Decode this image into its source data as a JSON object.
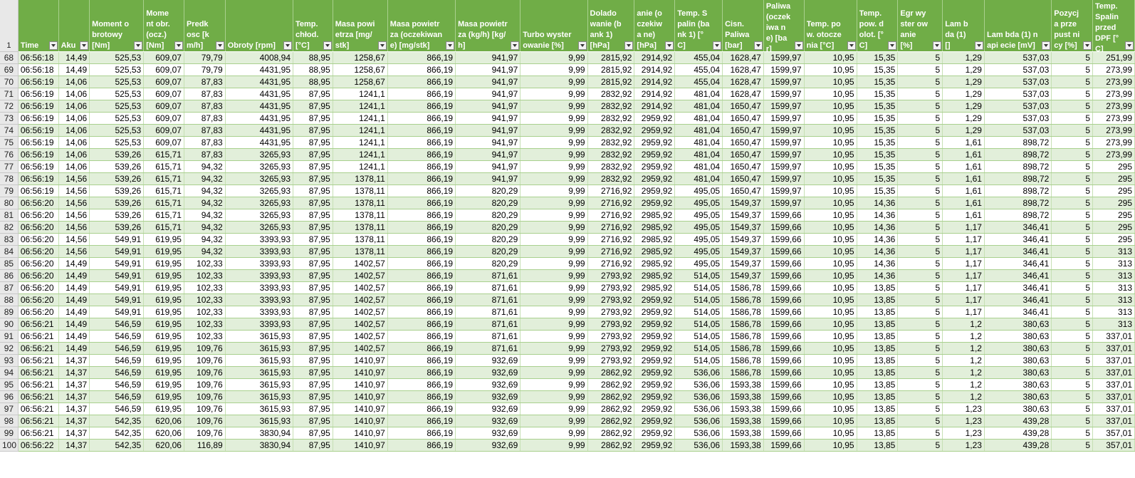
{
  "header_row_number": "1",
  "columns": [
    {
      "label": "Time",
      "width": 56
    },
    {
      "label": "Aku",
      "width": 43
    },
    {
      "label": "Moment obrotowy [Nm]",
      "width": 75
    },
    {
      "label": "Moment obr. (ocz.) [Nm]",
      "width": 56
    },
    {
      "label": "Predkosc [km/h]",
      "width": 57
    },
    {
      "label": "Obroty [rpm]",
      "width": 94
    },
    {
      "label": "Temp. chłod. [°C]",
      "width": 55
    },
    {
      "label": "Masa powietrza [mg/stk]",
      "width": 76
    },
    {
      "label": "Masa powietrza (oczekiwane) [mg/stk]",
      "width": 94
    },
    {
      "label": "Masa powietrza (kg/h) [kg/h]",
      "width": 90
    },
    {
      "label": "Turbo wyster owanie [%]",
      "width": 93
    },
    {
      "label": "Dolado wanie (bank 1) [hPa]",
      "width": 65
    },
    {
      "label": "anie (oczekiwa ne) [hPa]",
      "width": 56
    },
    {
      "label": "Temp. Spalin (bank 1) [°C]",
      "width": 66
    },
    {
      "label": "Cisn. Paliwa [bar]",
      "width": 57
    },
    {
      "label": "Paliwa (oczekiwa ne) [bar]",
      "width": 56
    },
    {
      "label": "Temp. pow. otoczenia [°C]",
      "width": 73
    },
    {
      "label": "Temp. pow. dolot. [°C]",
      "width": 57
    },
    {
      "label": "Egr wyster owanie [%]",
      "width": 62
    },
    {
      "label": "Lam bda (1) []",
      "width": 58
    },
    {
      "label": "Lam bda (1) napi ecie [mV]",
      "width": 93
    },
    {
      "label": "Pozycja przepust nicy [%]",
      "width": 57
    },
    {
      "label": "Temp. Spalin przed DPF [°C]",
      "width": 58
    }
  ],
  "rows": [
    {
      "n": "68",
      "c": [
        "06:56:18",
        "14,49",
        "525,53",
        "609,07",
        "79,79",
        "4008,94",
        "88,95",
        "1258,67",
        "866,19",
        "941,97",
        "9,99",
        "2815,92",
        "2914,92",
        "455,04",
        "1628,47",
        "1599,97",
        "10,95",
        "15,35",
        "5",
        "1,29",
        "537,03",
        "5",
        "251,99"
      ]
    },
    {
      "n": "69",
      "c": [
        "06:56:18",
        "14,49",
        "525,53",
        "609,07",
        "79,79",
        "4431,95",
        "88,95",
        "1258,67",
        "866,19",
        "941,97",
        "9,99",
        "2815,92",
        "2914,92",
        "455,04",
        "1628,47",
        "1599,97",
        "10,95",
        "15,35",
        "5",
        "1,29",
        "537,03",
        "5",
        "273,99"
      ]
    },
    {
      "n": "70",
      "c": [
        "06:56:19",
        "14,06",
        "525,53",
        "609,07",
        "87,83",
        "4431,95",
        "88,95",
        "1258,67",
        "866,19",
        "941,97",
        "9,99",
        "2815,92",
        "2914,92",
        "455,04",
        "1628,47",
        "1599,97",
        "10,95",
        "15,35",
        "5",
        "1,29",
        "537,03",
        "5",
        "273,99"
      ]
    },
    {
      "n": "71",
      "c": [
        "06:56:19",
        "14,06",
        "525,53",
        "609,07",
        "87,83",
        "4431,95",
        "87,95",
        "1241,1",
        "866,19",
        "941,97",
        "9,99",
        "2832,92",
        "2914,92",
        "481,04",
        "1628,47",
        "1599,97",
        "10,95",
        "15,35",
        "5",
        "1,29",
        "537,03",
        "5",
        "273,99"
      ]
    },
    {
      "n": "72",
      "c": [
        "06:56:19",
        "14,06",
        "525,53",
        "609,07",
        "87,83",
        "4431,95",
        "87,95",
        "1241,1",
        "866,19",
        "941,97",
        "9,99",
        "2832,92",
        "2914,92",
        "481,04",
        "1650,47",
        "1599,97",
        "10,95",
        "15,35",
        "5",
        "1,29",
        "537,03",
        "5",
        "273,99"
      ]
    },
    {
      "n": "73",
      "c": [
        "06:56:19",
        "14,06",
        "525,53",
        "609,07",
        "87,83",
        "4431,95",
        "87,95",
        "1241,1",
        "866,19",
        "941,97",
        "9,99",
        "2832,92",
        "2959,92",
        "481,04",
        "1650,47",
        "1599,97",
        "10,95",
        "15,35",
        "5",
        "1,29",
        "537,03",
        "5",
        "273,99"
      ]
    },
    {
      "n": "74",
      "c": [
        "06:56:19",
        "14,06",
        "525,53",
        "609,07",
        "87,83",
        "4431,95",
        "87,95",
        "1241,1",
        "866,19",
        "941,97",
        "9,99",
        "2832,92",
        "2959,92",
        "481,04",
        "1650,47",
        "1599,97",
        "10,95",
        "15,35",
        "5",
        "1,29",
        "537,03",
        "5",
        "273,99"
      ]
    },
    {
      "n": "75",
      "c": [
        "06:56:19",
        "14,06",
        "525,53",
        "609,07",
        "87,83",
        "4431,95",
        "87,95",
        "1241,1",
        "866,19",
        "941,97",
        "9,99",
        "2832,92",
        "2959,92",
        "481,04",
        "1650,47",
        "1599,97",
        "10,95",
        "15,35",
        "5",
        "1,61",
        "898,72",
        "5",
        "273,99"
      ]
    },
    {
      "n": "76",
      "c": [
        "06:56:19",
        "14,06",
        "539,26",
        "615,71",
        "87,83",
        "3265,93",
        "87,95",
        "1241,1",
        "866,19",
        "941,97",
        "9,99",
        "2832,92",
        "2959,92",
        "481,04",
        "1650,47",
        "1599,97",
        "10,95",
        "15,35",
        "5",
        "1,61",
        "898,72",
        "5",
        "273,99"
      ]
    },
    {
      "n": "77",
      "c": [
        "06:56:19",
        "14,06",
        "539,26",
        "615,71",
        "94,32",
        "3265,93",
        "87,95",
        "1241,1",
        "866,19",
        "941,97",
        "9,99",
        "2832,92",
        "2959,92",
        "481,04",
        "1650,47",
        "1599,97",
        "10,95",
        "15,35",
        "5",
        "1,61",
        "898,72",
        "5",
        "295"
      ]
    },
    {
      "n": "78",
      "c": [
        "06:56:19",
        "14,56",
        "539,26",
        "615,71",
        "94,32",
        "3265,93",
        "87,95",
        "1378,11",
        "866,19",
        "941,97",
        "9,99",
        "2832,92",
        "2959,92",
        "481,04",
        "1650,47",
        "1599,97",
        "10,95",
        "15,35",
        "5",
        "1,61",
        "898,72",
        "5",
        "295"
      ]
    },
    {
      "n": "79",
      "c": [
        "06:56:19",
        "14,56",
        "539,26",
        "615,71",
        "94,32",
        "3265,93",
        "87,95",
        "1378,11",
        "866,19",
        "820,29",
        "9,99",
        "2716,92",
        "2959,92",
        "495,05",
        "1650,47",
        "1599,97",
        "10,95",
        "15,35",
        "5",
        "1,61",
        "898,72",
        "5",
        "295"
      ]
    },
    {
      "n": "80",
      "c": [
        "06:56:20",
        "14,56",
        "539,26",
        "615,71",
        "94,32",
        "3265,93",
        "87,95",
        "1378,11",
        "866,19",
        "820,29",
        "9,99",
        "2716,92",
        "2959,92",
        "495,05",
        "1549,37",
        "1599,97",
        "10,95",
        "14,36",
        "5",
        "1,61",
        "898,72",
        "5",
        "295"
      ]
    },
    {
      "n": "81",
      "c": [
        "06:56:20",
        "14,56",
        "539,26",
        "615,71",
        "94,32",
        "3265,93",
        "87,95",
        "1378,11",
        "866,19",
        "820,29",
        "9,99",
        "2716,92",
        "2985,92",
        "495,05",
        "1549,37",
        "1599,66",
        "10,95",
        "14,36",
        "5",
        "1,61",
        "898,72",
        "5",
        "295"
      ]
    },
    {
      "n": "82",
      "c": [
        "06:56:20",
        "14,56",
        "539,26",
        "615,71",
        "94,32",
        "3265,93",
        "87,95",
        "1378,11",
        "866,19",
        "820,29",
        "9,99",
        "2716,92",
        "2985,92",
        "495,05",
        "1549,37",
        "1599,66",
        "10,95",
        "14,36",
        "5",
        "1,17",
        "346,41",
        "5",
        "295"
      ]
    },
    {
      "n": "83",
      "c": [
        "06:56:20",
        "14,56",
        "549,91",
        "619,95",
        "94,32",
        "3393,93",
        "87,95",
        "1378,11",
        "866,19",
        "820,29",
        "9,99",
        "2716,92",
        "2985,92",
        "495,05",
        "1549,37",
        "1599,66",
        "10,95",
        "14,36",
        "5",
        "1,17",
        "346,41",
        "5",
        "295"
      ]
    },
    {
      "n": "84",
      "c": [
        "06:56:20",
        "14,56",
        "549,91",
        "619,95",
        "94,32",
        "3393,93",
        "87,95",
        "1378,11",
        "866,19",
        "820,29",
        "9,99",
        "2716,92",
        "2985,92",
        "495,05",
        "1549,37",
        "1599,66",
        "10,95",
        "14,36",
        "5",
        "1,17",
        "346,41",
        "5",
        "313"
      ]
    },
    {
      "n": "85",
      "c": [
        "06:56:20",
        "14,49",
        "549,91",
        "619,95",
        "102,33",
        "3393,93",
        "87,95",
        "1402,57",
        "866,19",
        "820,29",
        "9,99",
        "2716,92",
        "2985,92",
        "495,05",
        "1549,37",
        "1599,66",
        "10,95",
        "14,36",
        "5",
        "1,17",
        "346,41",
        "5",
        "313"
      ]
    },
    {
      "n": "86",
      "c": [
        "06:56:20",
        "14,49",
        "549,91",
        "619,95",
        "102,33",
        "3393,93",
        "87,95",
        "1402,57",
        "866,19",
        "871,61",
        "9,99",
        "2793,92",
        "2985,92",
        "514,05",
        "1549,37",
        "1599,66",
        "10,95",
        "14,36",
        "5",
        "1,17",
        "346,41",
        "5",
        "313"
      ]
    },
    {
      "n": "87",
      "c": [
        "06:56:20",
        "14,49",
        "549,91",
        "619,95",
        "102,33",
        "3393,93",
        "87,95",
        "1402,57",
        "866,19",
        "871,61",
        "9,99",
        "2793,92",
        "2985,92",
        "514,05",
        "1586,78",
        "1599,66",
        "10,95",
        "13,85",
        "5",
        "1,17",
        "346,41",
        "5",
        "313"
      ]
    },
    {
      "n": "88",
      "c": [
        "06:56:20",
        "14,49",
        "549,91",
        "619,95",
        "102,33",
        "3393,93",
        "87,95",
        "1402,57",
        "866,19",
        "871,61",
        "9,99",
        "2793,92",
        "2959,92",
        "514,05",
        "1586,78",
        "1599,66",
        "10,95",
        "13,85",
        "5",
        "1,17",
        "346,41",
        "5",
        "313"
      ]
    },
    {
      "n": "89",
      "c": [
        "06:56:20",
        "14,49",
        "549,91",
        "619,95",
        "102,33",
        "3393,93",
        "87,95",
        "1402,57",
        "866,19",
        "871,61",
        "9,99",
        "2793,92",
        "2959,92",
        "514,05",
        "1586,78",
        "1599,66",
        "10,95",
        "13,85",
        "5",
        "1,17",
        "346,41",
        "5",
        "313"
      ]
    },
    {
      "n": "90",
      "c": [
        "06:56:21",
        "14,49",
        "546,59",
        "619,95",
        "102,33",
        "3393,93",
        "87,95",
        "1402,57",
        "866,19",
        "871,61",
        "9,99",
        "2793,92",
        "2959,92",
        "514,05",
        "1586,78",
        "1599,66",
        "10,95",
        "13,85",
        "5",
        "1,2",
        "380,63",
        "5",
        "313"
      ]
    },
    {
      "n": "91",
      "c": [
        "06:56:21",
        "14,49",
        "546,59",
        "619,95",
        "102,33",
        "3615,93",
        "87,95",
        "1402,57",
        "866,19",
        "871,61",
        "9,99",
        "2793,92",
        "2959,92",
        "514,05",
        "1586,78",
        "1599,66",
        "10,95",
        "13,85",
        "5",
        "1,2",
        "380,63",
        "5",
        "337,01"
      ]
    },
    {
      "n": "92",
      "c": [
        "06:56:21",
        "14,49",
        "546,59",
        "619,95",
        "109,76",
        "3615,93",
        "87,95",
        "1402,57",
        "866,19",
        "871,61",
        "9,99",
        "2793,92",
        "2959,92",
        "514,05",
        "1586,78",
        "1599,66",
        "10,95",
        "13,85",
        "5",
        "1,2",
        "380,63",
        "5",
        "337,01"
      ]
    },
    {
      "n": "93",
      "c": [
        "06:56:21",
        "14,37",
        "546,59",
        "619,95",
        "109,76",
        "3615,93",
        "87,95",
        "1410,97",
        "866,19",
        "932,69",
        "9,99",
        "2793,92",
        "2959,92",
        "514,05",
        "1586,78",
        "1599,66",
        "10,95",
        "13,85",
        "5",
        "1,2",
        "380,63",
        "5",
        "337,01"
      ]
    },
    {
      "n": "94",
      "c": [
        "06:56:21",
        "14,37",
        "546,59",
        "619,95",
        "109,76",
        "3615,93",
        "87,95",
        "1410,97",
        "866,19",
        "932,69",
        "9,99",
        "2862,92",
        "2959,92",
        "536,06",
        "1586,78",
        "1599,66",
        "10,95",
        "13,85",
        "5",
        "1,2",
        "380,63",
        "5",
        "337,01"
      ]
    },
    {
      "n": "95",
      "c": [
        "06:56:21",
        "14,37",
        "546,59",
        "619,95",
        "109,76",
        "3615,93",
        "87,95",
        "1410,97",
        "866,19",
        "932,69",
        "9,99",
        "2862,92",
        "2959,92",
        "536,06",
        "1593,38",
        "1599,66",
        "10,95",
        "13,85",
        "5",
        "1,2",
        "380,63",
        "5",
        "337,01"
      ]
    },
    {
      "n": "96",
      "c": [
        "06:56:21",
        "14,37",
        "546,59",
        "619,95",
        "109,76",
        "3615,93",
        "87,95",
        "1410,97",
        "866,19",
        "932,69",
        "9,99",
        "2862,92",
        "2959,92",
        "536,06",
        "1593,38",
        "1599,66",
        "10,95",
        "13,85",
        "5",
        "1,2",
        "380,63",
        "5",
        "337,01"
      ]
    },
    {
      "n": "97",
      "c": [
        "06:56:21",
        "14,37",
        "546,59",
        "619,95",
        "109,76",
        "3615,93",
        "87,95",
        "1410,97",
        "866,19",
        "932,69",
        "9,99",
        "2862,92",
        "2959,92",
        "536,06",
        "1593,38",
        "1599,66",
        "10,95",
        "13,85",
        "5",
        "1,23",
        "380,63",
        "5",
        "337,01"
      ]
    },
    {
      "n": "98",
      "c": [
        "06:56:21",
        "14,37",
        "542,35",
        "620,06",
        "109,76",
        "3615,93",
        "87,95",
        "1410,97",
        "866,19",
        "932,69",
        "9,99",
        "2862,92",
        "2959,92",
        "536,06",
        "1593,38",
        "1599,66",
        "10,95",
        "13,85",
        "5",
        "1,23",
        "439,28",
        "5",
        "337,01"
      ]
    },
    {
      "n": "99",
      "c": [
        "06:56:21",
        "14,37",
        "542,35",
        "620,06",
        "109,76",
        "3830,94",
        "87,95",
        "1410,97",
        "866,19",
        "932,69",
        "9,99",
        "2862,92",
        "2959,92",
        "536,06",
        "1593,38",
        "1599,66",
        "10,95",
        "13,85",
        "5",
        "1,23",
        "439,28",
        "5",
        "357,01"
      ]
    },
    {
      "n": "100",
      "c": [
        "06:56:22",
        "14,37",
        "542,35",
        "620,06",
        "116,89",
        "3830,94",
        "87,95",
        "1410,97",
        "866,19",
        "932,69",
        "9,99",
        "2862,92",
        "2959,92",
        "536,06",
        "1593,38",
        "1599,66",
        "10,95",
        "13,85",
        "5",
        "1,23",
        "439,28",
        "5",
        "357,01"
      ]
    }
  ],
  "colors": {
    "header_bg": "#70ad47",
    "band_light": "#e2efda",
    "band_white": "#ffffff",
    "row_number_bg": "#e8e8e8"
  },
  "icons": {
    "filter": "filter-dropdown-icon"
  }
}
